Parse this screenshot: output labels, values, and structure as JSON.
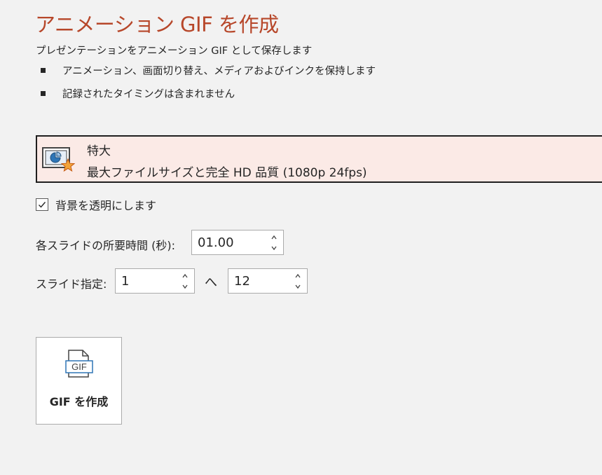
{
  "title": "アニメーション GIF を作成",
  "subtitle": "プレゼンテーションをアニメーション GIF として保存します",
  "bullets": [
    "アニメーション、画面切り替え、メディアおよびインクを保持します",
    "記録されたタイミングは含まれません"
  ],
  "quality": {
    "name": "特大",
    "description": "最大ファイルサイズと完全 HD 品質 (1080p 24fps)",
    "icon": "presentation-star-icon"
  },
  "transparent_background": {
    "label": "背景を透明にします",
    "checked": true
  },
  "duration": {
    "label": "各スライドの所要時間 (秒):",
    "value": "01.00"
  },
  "slide_range": {
    "label": "スライド指定:",
    "from": "1",
    "separator": "へ",
    "to": "12"
  },
  "create_button": {
    "label": "GIF を作成",
    "icon": "gif-file-icon"
  },
  "colors": {
    "title": "#b7472a",
    "background": "#f2f2f2",
    "selected_fill": "#fbeae6",
    "accent_blue": "#2e75b6",
    "star": "#f2a33a"
  }
}
